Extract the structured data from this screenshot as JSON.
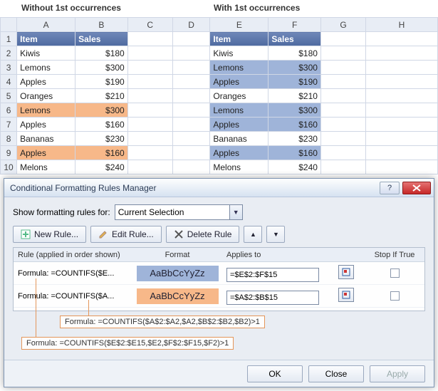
{
  "headings": {
    "left": "Without 1st occurrences",
    "right": "With 1st occurrences"
  },
  "columns": [
    "A",
    "B",
    "C",
    "D",
    "E",
    "F",
    "G",
    "H"
  ],
  "rows": {
    "header": {
      "item": "Item",
      "sales": "Sales"
    },
    "data": [
      {
        "n": "2",
        "item": "Kiwis",
        "sales": "$180"
      },
      {
        "n": "3",
        "item": "Lemons",
        "sales": "$300"
      },
      {
        "n": "4",
        "item": "Apples",
        "sales": "$190"
      },
      {
        "n": "5",
        "item": "Oranges",
        "sales": "$210"
      },
      {
        "n": "6",
        "item": "Lemons",
        "sales": "$300"
      },
      {
        "n": "7",
        "item": "Apples",
        "sales": "$160"
      },
      {
        "n": "8",
        "item": "Bananas",
        "sales": "$230"
      },
      {
        "n": "9",
        "item": "Apples",
        "sales": "$160"
      },
      {
        "n": "10",
        "item": "Melons",
        "sales": "$240"
      }
    ]
  },
  "highlight": {
    "left_orange_rows": [
      "6",
      "9"
    ],
    "right_blue_rows": [
      "3",
      "4",
      "6",
      "7",
      "9"
    ]
  },
  "dialog": {
    "title": "Conditional Formatting Rules Manager",
    "show_label": "Show formatting rules for:",
    "scope": "Current Selection",
    "buttons": {
      "new": "New Rule...",
      "edit": "Edit Rule...",
      "delete": "Delete Rule"
    },
    "headers": {
      "rule": "Rule (applied in order shown)",
      "format": "Format",
      "applies": "Applies to",
      "stop": "Stop If True"
    },
    "sample": "AaBbCcYyZz",
    "rules": [
      {
        "text": "Formula: =COUNTIFS($E...",
        "style": "blue",
        "applies": "=$E$2:$F$15"
      },
      {
        "text": "Formula: =COUNTIFS($A...",
        "style": "orange",
        "applies": "=$A$2:$B$15"
      }
    ],
    "footer": {
      "ok": "OK",
      "close": "Close",
      "apply": "Apply"
    }
  },
  "callouts": {
    "c1": "Formula: =COUNTIFS($A$2:$A2,$A2,$B$2:$B2,$B2)>1",
    "c2": "Formula: =COUNTIFS($E$2:$E15,$E2,$F$2:$F15,$F2)>1"
  }
}
